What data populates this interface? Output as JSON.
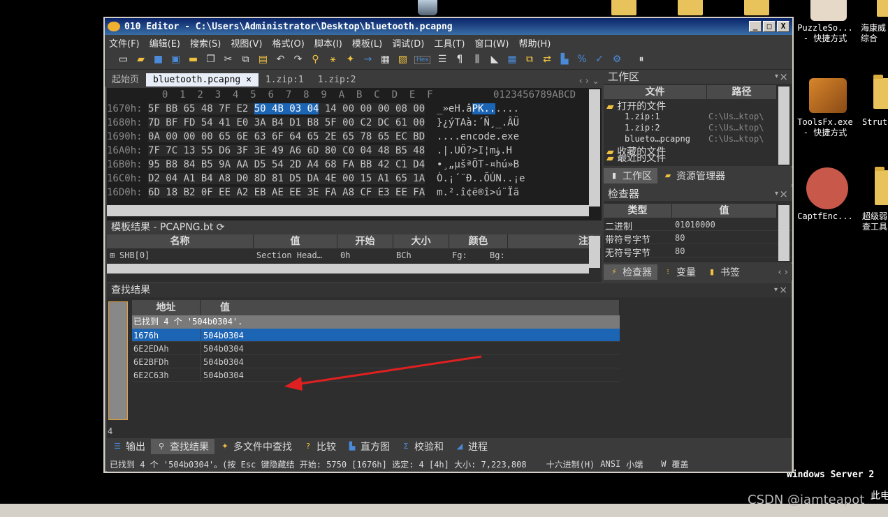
{
  "desktop": {
    "icons": [
      {
        "label": "PuzzleSo...\n- 快捷方式"
      },
      {
        "label": "海康威\n综合"
      },
      {
        "label": "ToolsFx.exe\n- 快捷方式"
      },
      {
        "label": "Strut"
      },
      {
        "label": "CaptfEnc..."
      },
      {
        "label": "超级弱\n查工具"
      }
    ],
    "server_text": "Windows Server 2",
    "server_text2": "此电",
    "watermark": "CSDN @iamteapot"
  },
  "window": {
    "title": "010 Editor - C:\\Users\\Administrator\\Desktop\\bluetooth.pcapng",
    "btn_min": "_",
    "btn_max": "□",
    "btn_close": "X"
  },
  "menu": [
    "文件(F)",
    "编辑(E)",
    "搜索(S)",
    "视图(V)",
    "格式(O)",
    "脚本(I)",
    "模板(L)",
    "调试(D)",
    "工具(T)",
    "窗口(W)",
    "帮助(H)"
  ],
  "toolbar": {
    "hex_label": "Hex"
  },
  "tabs": [
    "起始页",
    "bluetooth.pcapng",
    "1.zip:1",
    "1.zip:2"
  ],
  "tab_close": "×",
  "hex": {
    "col_header": "  0  1  2  3  4  5  6  7  8  9  A  B  C  D  E  F",
    "ascii_header": "0123456789ABCD",
    "rows": [
      {
        "addr": "1670h:",
        "pre": "5F BB 65 48 7F E2 ",
        "sel": "50 4B 03 04",
        "post": " 14 00 00 00 08 00",
        "ascii_pre": "_»eH.â",
        "ascii_sel": "PK..",
        "ascii_post": "...."
      },
      {
        "addr": "1680h:",
        "pre": "7D BF FD 54 41 E0 3A B4 D1 B8 5F 00 C2 DC 61 00",
        "sel": "",
        "post": "",
        "ascii_pre": "}¿ýTAà:´Ñ¸_.ÂÜ",
        "ascii_sel": "",
        "ascii_post": ""
      },
      {
        "addr": "1690h:",
        "pre": "0A 00 00 00 65 6E 63 6F 64 65 2E 65 78 65 EC BD",
        "sel": "",
        "post": "",
        "ascii_pre": "....encode.exe",
        "ascii_sel": "",
        "ascii_post": ""
      },
      {
        "addr": "16A0h:",
        "pre": "7F 7C 13 55 D6 3F 3E 49 A6 6D 80 C0 04 48 B5 48",
        "sel": "",
        "post": "",
        "ascii_pre": ".|.UÖ?>I¦mۈ.H",
        "ascii_sel": "",
        "ascii_post": ""
      },
      {
        "addr": "16B0h:",
        "pre": "95 B8 84 B5 9A AA D5 54 2D A4 68 FA BB 42 C1 D4",
        "sel": "",
        "post": "",
        "ascii_pre": "•¸„µšªÕT-¤hú»B",
        "ascii_sel": "",
        "ascii_post": ""
      },
      {
        "addr": "16C0h:",
        "pre": "D2 04 A1 B4 A8 D0 8D 81 D5 DA 4E 00 15 A1 65 1A",
        "sel": "",
        "post": "",
        "ascii_pre": "Ò.¡´¨Ð..ÕÚN..¡e",
        "ascii_sel": "",
        "ascii_post": ""
      },
      {
        "addr": "16D0h:",
        "pre": "6D 18 B2 0F EE A2 EB AE EE 3E FA A8 CF E3 EE FA",
        "sel": "",
        "post": "",
        "ascii_pre": "m.².î¢ë®î>ú¨Ïã",
        "ascii_sel": "",
        "ascii_post": ""
      }
    ]
  },
  "template": {
    "title": "模板结果 - PCAPNG.bt",
    "headers": [
      "名称",
      "值",
      "开始",
      "大小",
      "颜色",
      "注释"
    ],
    "rows": [
      {
        "name": "SHB[0]",
        "value": "Section Head…",
        "start": "0h",
        "size": "BCh",
        "fg": "Fg:",
        "bg": "Bg:"
      }
    ]
  },
  "find": {
    "title": "查找结果",
    "headers": [
      "地址",
      "值"
    ],
    "summary": "已找到 4 个 '504b0304'.",
    "rows": [
      {
        "addr": "1676h",
        "value": "504b0304"
      },
      {
        "addr": "6E2EDAh",
        "value": "504b0304"
      },
      {
        "addr": "6E2BFDh",
        "value": "504b0304"
      },
      {
        "addr": "6E2C63h",
        "value": "504b0304"
      }
    ],
    "gutter_num": "4"
  },
  "bottom_tabs": [
    "输出",
    "查找结果",
    "多文件中查找",
    "比较",
    "直方图",
    "校验和",
    "进程"
  ],
  "status": {
    "left": "已找到 4 个 '504b0304'。(按 Esc 键隐藏结 开始: 5750 [1676h] 选定: 4 [4h] 大小: 7,223,808",
    "mode": "十六进制(H)",
    "encoding": "ANSI",
    "endian": "小端",
    "w": "W",
    "overwrite": "覆盖"
  },
  "workspace": {
    "title": "工作区",
    "headers": [
      "文件",
      "路径"
    ],
    "open_files_label": "打开的文件",
    "files": [
      {
        "name": "1.zip:1",
        "path": "C:\\Us…ktop\\"
      },
      {
        "name": "1.zip:2",
        "path": "C:\\Us…ktop\\"
      },
      {
        "name": "blueto…pcapng",
        "path": "C:\\Us…ktop\\"
      }
    ],
    "favorites_label": "收藏的文件",
    "recent_label": "最近的文件",
    "tabs": [
      "工作区",
      "资源管理器"
    ]
  },
  "inspector": {
    "title": "检查器",
    "headers": [
      "类型",
      "值"
    ],
    "rows": [
      {
        "type": "二进制",
        "value": "01010000"
      },
      {
        "type": "带符号字节",
        "value": "80"
      },
      {
        "type": "无符号字节",
        "value": "80"
      }
    ],
    "tabs": [
      "检查器",
      "变量",
      "书签"
    ]
  }
}
